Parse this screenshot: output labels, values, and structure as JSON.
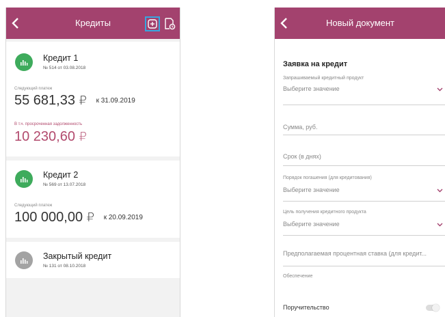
{
  "loans_screen": {
    "title": "Кредиты",
    "loans": [
      {
        "name": "Кредит 1",
        "number": "№ 514 от 03.08.2018",
        "next_payment_label": "Следующий платеж",
        "next_payment_amount": "55 681,33",
        "currency": "₽",
        "next_payment_date": "к 31.09.2019",
        "overdue_label": "В т.ч. просроченная задолженность",
        "overdue_amount": "10 230,60"
      },
      {
        "name": "Кредит 2",
        "number": "№ 569 от 13.07.2018",
        "next_payment_label": "Следующий платеж",
        "next_payment_amount": "100 000,00",
        "currency": "₽",
        "next_payment_date": "к 20.09.2019"
      },
      {
        "name": "Закрытый кредит",
        "number": "№ 131 от 08.10.2018"
      }
    ],
    "icons": [
      "back-arrow-icon",
      "add-icon",
      "document-icon",
      "loan-chart-icon"
    ],
    "colors": {
      "header": "#a3426e",
      "active_loan": "#3eab5c",
      "closed_loan": "#a3a3a3",
      "overdue": "#b24a6d",
      "highlight": "#36a7e0"
    }
  },
  "form_screen": {
    "title": "Новый документ",
    "form_title": "Заявка на кредит",
    "fields": [
      {
        "label": "Запрашиваемый кредитный продукт",
        "value": "Выберите значение"
      },
      {
        "placeholder": "Сумма, руб."
      },
      {
        "placeholder": "Срок (в днях)"
      },
      {
        "label": "Порядок погашения (для кредитования)",
        "value": "Выберите значение"
      },
      {
        "label": "Цель получения кредитного продукта",
        "value": "Выберите значение"
      },
      {
        "placeholder": "Предполагаемая процентная ставка (для кредит..."
      },
      {
        "label": "Обеспечение"
      }
    ],
    "guarantee_label": "Поручительство",
    "guarantee_enabled": false
  }
}
